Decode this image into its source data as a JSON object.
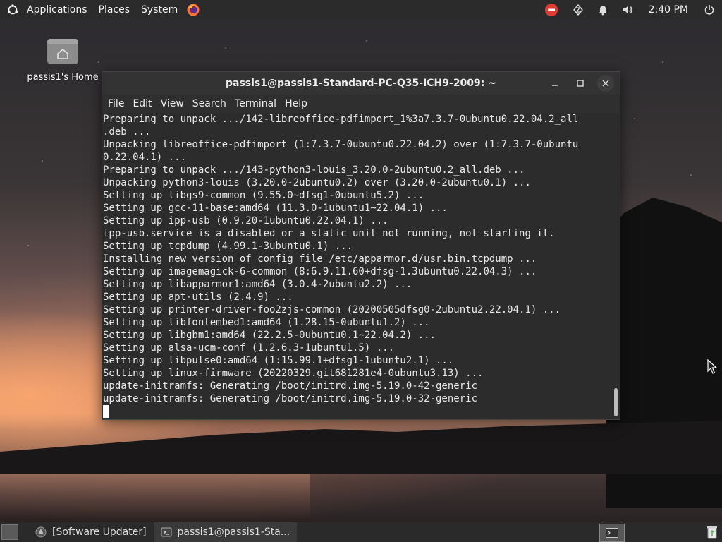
{
  "top_panel": {
    "menus": [
      "Applications",
      "Places",
      "System"
    ],
    "clock": "2:40 PM",
    "icons": [
      "ubuntu-logo-icon",
      "firefox-icon",
      "stop-update-icon",
      "network-icon",
      "bell-icon",
      "volume-icon",
      "power-icon"
    ],
    "colors": {
      "update_badge": "#e53935",
      "firefox": "#ff7139"
    }
  },
  "desktop": {
    "home_label": "passis1's Home"
  },
  "terminal": {
    "title": "passis1@passis1-Standard-PC-Q35-ICH9-2009: ~",
    "menu": [
      "File",
      "Edit",
      "View",
      "Search",
      "Terminal",
      "Help"
    ],
    "lines": [
      "Preparing to unpack .../142-libreoffice-pdfimport_1%3a7.3.7-0ubuntu0.22.04.2_all",
      ".deb ...",
      "Unpacking libreoffice-pdfimport (1:7.3.7-0ubuntu0.22.04.2) over (1:7.3.7-0ubuntu",
      "0.22.04.1) ...",
      "Preparing to unpack .../143-python3-louis_3.20.0-2ubuntu0.2_all.deb ...",
      "Unpacking python3-louis (3.20.0-2ubuntu0.2) over (3.20.0-2ubuntu0.1) ...",
      "Setting up libgs9-common (9.55.0~dfsg1-0ubuntu5.2) ...",
      "Setting up gcc-11-base:amd64 (11.3.0-1ubuntu1~22.04.1) ...",
      "Setting up ipp-usb (0.9.20-1ubuntu0.22.04.1) ...",
      "ipp-usb.service is a disabled or a static unit not running, not starting it.",
      "Setting up tcpdump (4.99.1-3ubuntu0.1) ...",
      "Installing new version of config file /etc/apparmor.d/usr.bin.tcpdump ...",
      "Setting up imagemagick-6-common (8:6.9.11.60+dfsg-1.3ubuntu0.22.04.3) ...",
      "Setting up libapparmor1:amd64 (3.0.4-2ubuntu2.2) ...",
      "Setting up apt-utils (2.4.9) ...",
      "Setting up printer-driver-foo2zjs-common (20200505dfsg0-2ubuntu2.22.04.1) ...",
      "Setting up libfontembed1:amd64 (1.28.15-0ubuntu1.2) ...",
      "Setting up libgbm1:amd64 (22.2.5-0ubuntu0.1~22.04.2) ...",
      "Setting up alsa-ucm-conf (1.2.6.3-1ubuntu1.5) ...",
      "Setting up libpulse0:amd64 (1:15.99.1+dfsg1-1ubuntu2.1) ...",
      "Setting up linux-firmware (20220329.git681281e4-0ubuntu3.13) ...",
      "update-initramfs: Generating /boot/initrd.img-5.19.0-42-generic",
      "update-initramfs: Generating /boot/initrd.img-5.19.0-32-generic"
    ]
  },
  "taskbar": {
    "tasks": [
      "[Software Updater]",
      "passis1@passis1-Sta..."
    ]
  }
}
